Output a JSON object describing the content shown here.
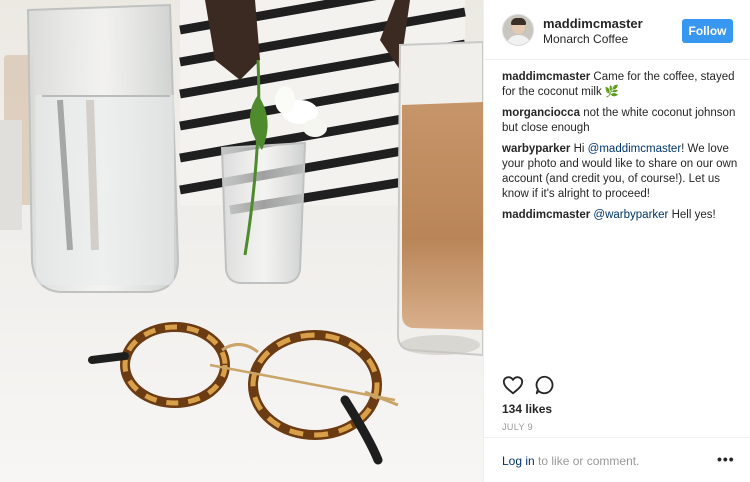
{
  "post": {
    "username": "maddimcmaster",
    "location": "Monarch Coffee",
    "follow_label": "Follow"
  },
  "comments": [
    {
      "author": "maddimcmaster",
      "text": "Came for the coffee, stayed for the coconut milk 🌿"
    },
    {
      "author": "morganciocca",
      "text": "not the white coconut johnson but close enough"
    },
    {
      "author": "warbyparker",
      "text_before": "Hi ",
      "mention": "@maddimcmaster",
      "text_after": "! We love your photo and would like to share on our own account (and credit you, of course!). Let us know if it's alright to proceed!"
    },
    {
      "author": "maddimcmaster",
      "mention": "@warbyparker",
      "text_after": " Hell yes!"
    }
  ],
  "actions": {
    "like_icon": "heart-icon",
    "comment_icon": "comment-bubble-icon"
  },
  "likes": "134 likes",
  "date": "JULY 9",
  "footer": {
    "login_link": "Log in",
    "login_text": " to like or comment.",
    "more": "•••"
  },
  "colors": {
    "follow": "#3897f0",
    "mention": "#003569",
    "muted": "#999999"
  }
}
